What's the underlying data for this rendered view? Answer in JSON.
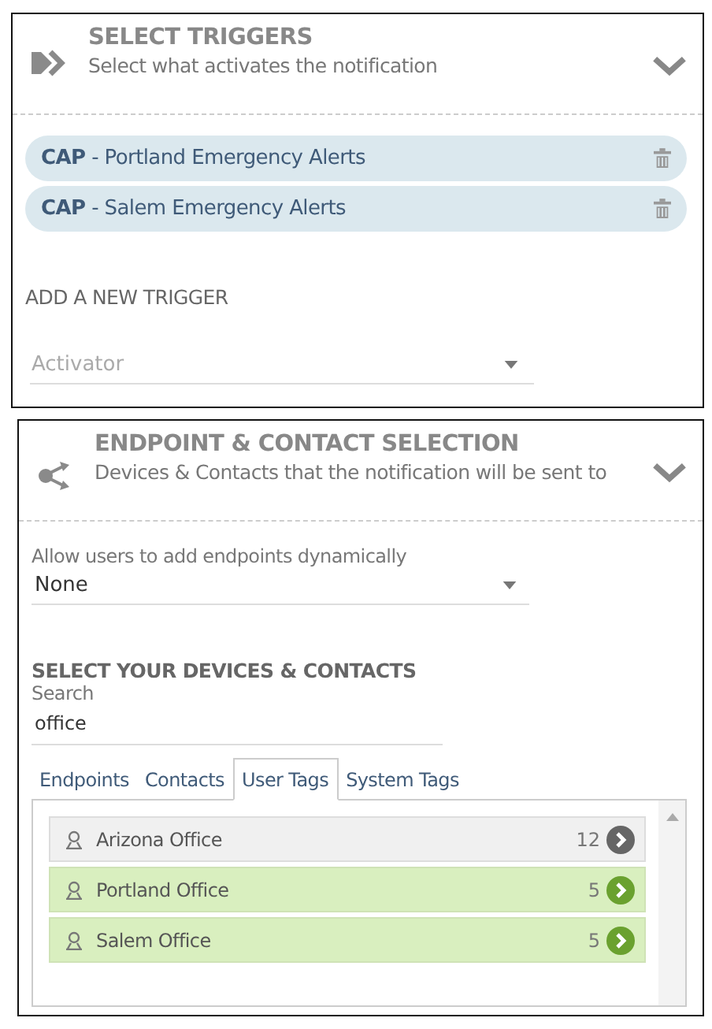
{
  "triggers_panel": {
    "title": "SELECT TRIGGERS",
    "subtitle": "Select what activates the notification",
    "expanded": true,
    "triggers": [
      {
        "source": "CAP",
        "name": " - Portland Emergency Alerts"
      },
      {
        "source": "CAP",
        "name": " - Salem Emergency Alerts"
      }
    ],
    "add_heading": "ADD A NEW TRIGGER",
    "activator": {
      "placeholder": "Activator"
    }
  },
  "endpoint_panel": {
    "title": "ENDPOINT & CONTACT SELECTION",
    "subtitle": "Devices & Contacts that the notification will be sent to",
    "expanded": true,
    "dynamic": {
      "label": "Allow users to add endpoints dynamically",
      "value": "None"
    },
    "select_heading": "SELECT YOUR DEVICES & CONTACTS",
    "search": {
      "label": "Search",
      "value": "office"
    },
    "tabs": [
      {
        "label": "Endpoints",
        "selected": false
      },
      {
        "label": "Contacts",
        "selected": false
      },
      {
        "label": "User Tags",
        "selected": true
      },
      {
        "label": "System Tags",
        "selected": false
      }
    ],
    "tags": [
      {
        "name": "Arizona Office",
        "count": "12",
        "selected": false
      },
      {
        "name": "Portland Office",
        "count": "5",
        "selected": true
      },
      {
        "name": "Salem Office",
        "count": "5",
        "selected": true
      }
    ]
  }
}
